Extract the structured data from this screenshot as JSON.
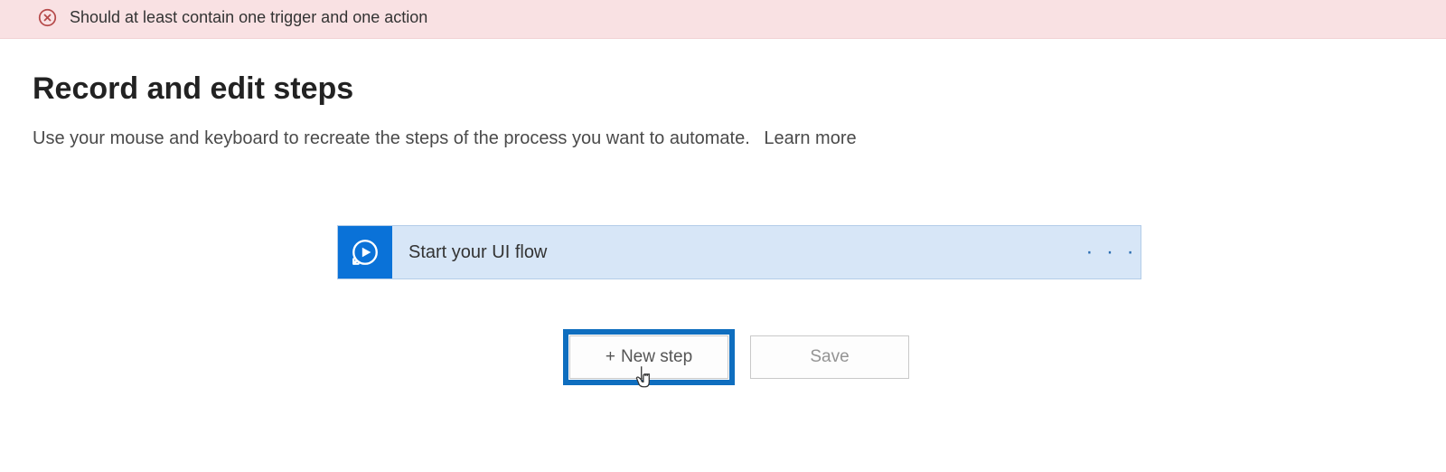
{
  "error": {
    "message": "Should at least contain one trigger and one action"
  },
  "header": {
    "title": "Record and edit steps",
    "subtitle": "Use your mouse and keyboard to recreate the steps of the process you want to automate.",
    "learn_more": "Learn more"
  },
  "flow": {
    "step_label": "Start your UI flow",
    "menu_ellipsis": "· · ·"
  },
  "buttons": {
    "new_step_plus": "+",
    "new_step": "New step",
    "save": "Save"
  },
  "icons": {
    "error_circle": "error-circle-icon",
    "record_play": "record-play-icon",
    "pointer_cursor": "pointer-cursor-icon"
  },
  "colors": {
    "error_bg": "#f9e1e3",
    "error_stroke": "#b64a4a",
    "step_bg": "#d7e6f7",
    "step_icon_bg": "#0a72d8",
    "highlight": "#0f6ebf"
  }
}
